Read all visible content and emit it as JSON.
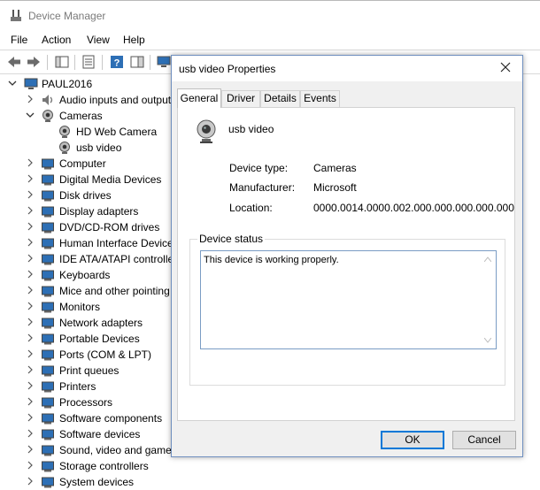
{
  "window": {
    "title": "Device Manager"
  },
  "menu": [
    "File",
    "Action",
    "View",
    "Help"
  ],
  "tree": {
    "root": "PAUL2016",
    "items": [
      {
        "label": "Audio inputs and outputs",
        "icon": "speaker-icon"
      },
      {
        "label": "Cameras",
        "icon": "camera-icon",
        "expanded": true,
        "children": [
          {
            "label": "HD Web Camera",
            "icon": "webcam-icon"
          },
          {
            "label": "usb video",
            "icon": "webcam-icon"
          }
        ]
      },
      {
        "label": "Computer",
        "icon": "computer-icon"
      },
      {
        "label": "Digital Media Devices",
        "icon": "media-device-icon"
      },
      {
        "label": "Disk drives",
        "icon": "disk-drive-icon"
      },
      {
        "label": "Display adapters",
        "icon": "display-adapter-icon"
      },
      {
        "label": "DVD/CD-ROM drives",
        "icon": "dvd-drive-icon"
      },
      {
        "label": "Human Interface Devices",
        "icon": "hid-icon"
      },
      {
        "label": "IDE ATA/ATAPI controllers",
        "icon": "ide-controller-icon"
      },
      {
        "label": "Keyboards",
        "icon": "keyboard-icon"
      },
      {
        "label": "Mice and other pointing devices",
        "icon": "mouse-icon"
      },
      {
        "label": "Monitors",
        "icon": "monitor-icon"
      },
      {
        "label": "Network adapters",
        "icon": "network-adapter-icon"
      },
      {
        "label": "Portable Devices",
        "icon": "portable-device-icon"
      },
      {
        "label": "Ports (COM & LPT)",
        "icon": "port-icon"
      },
      {
        "label": "Print queues",
        "icon": "print-queue-icon"
      },
      {
        "label": "Printers",
        "icon": "printer-icon"
      },
      {
        "label": "Processors",
        "icon": "processor-icon"
      },
      {
        "label": "Software components",
        "icon": "software-component-icon"
      },
      {
        "label": "Software devices",
        "icon": "software-device-icon"
      },
      {
        "label": "Sound, video and game controllers",
        "icon": "sound-icon"
      },
      {
        "label": "Storage controllers",
        "icon": "storage-controller-icon"
      },
      {
        "label": "System devices",
        "icon": "system-device-icon"
      }
    ]
  },
  "dialog": {
    "title": "usb video Properties",
    "tabs": [
      "General",
      "Driver",
      "Details",
      "Events"
    ],
    "active_tab": "General",
    "device_name": "usb video",
    "properties": [
      {
        "label": "Device type:",
        "value": "Cameras"
      },
      {
        "label": "Manufacturer:",
        "value": "Microsoft"
      },
      {
        "label": "Location:",
        "value": "0000.0014.0000.002.000.000.000.000.000"
      }
    ],
    "status_legend": "Device status",
    "status_text": "This device is working properly.",
    "ok_label": "OK",
    "cancel_label": "Cancel"
  },
  "colors": {
    "accent": "#0078d7",
    "icon_blue": "#2d6fb5"
  }
}
